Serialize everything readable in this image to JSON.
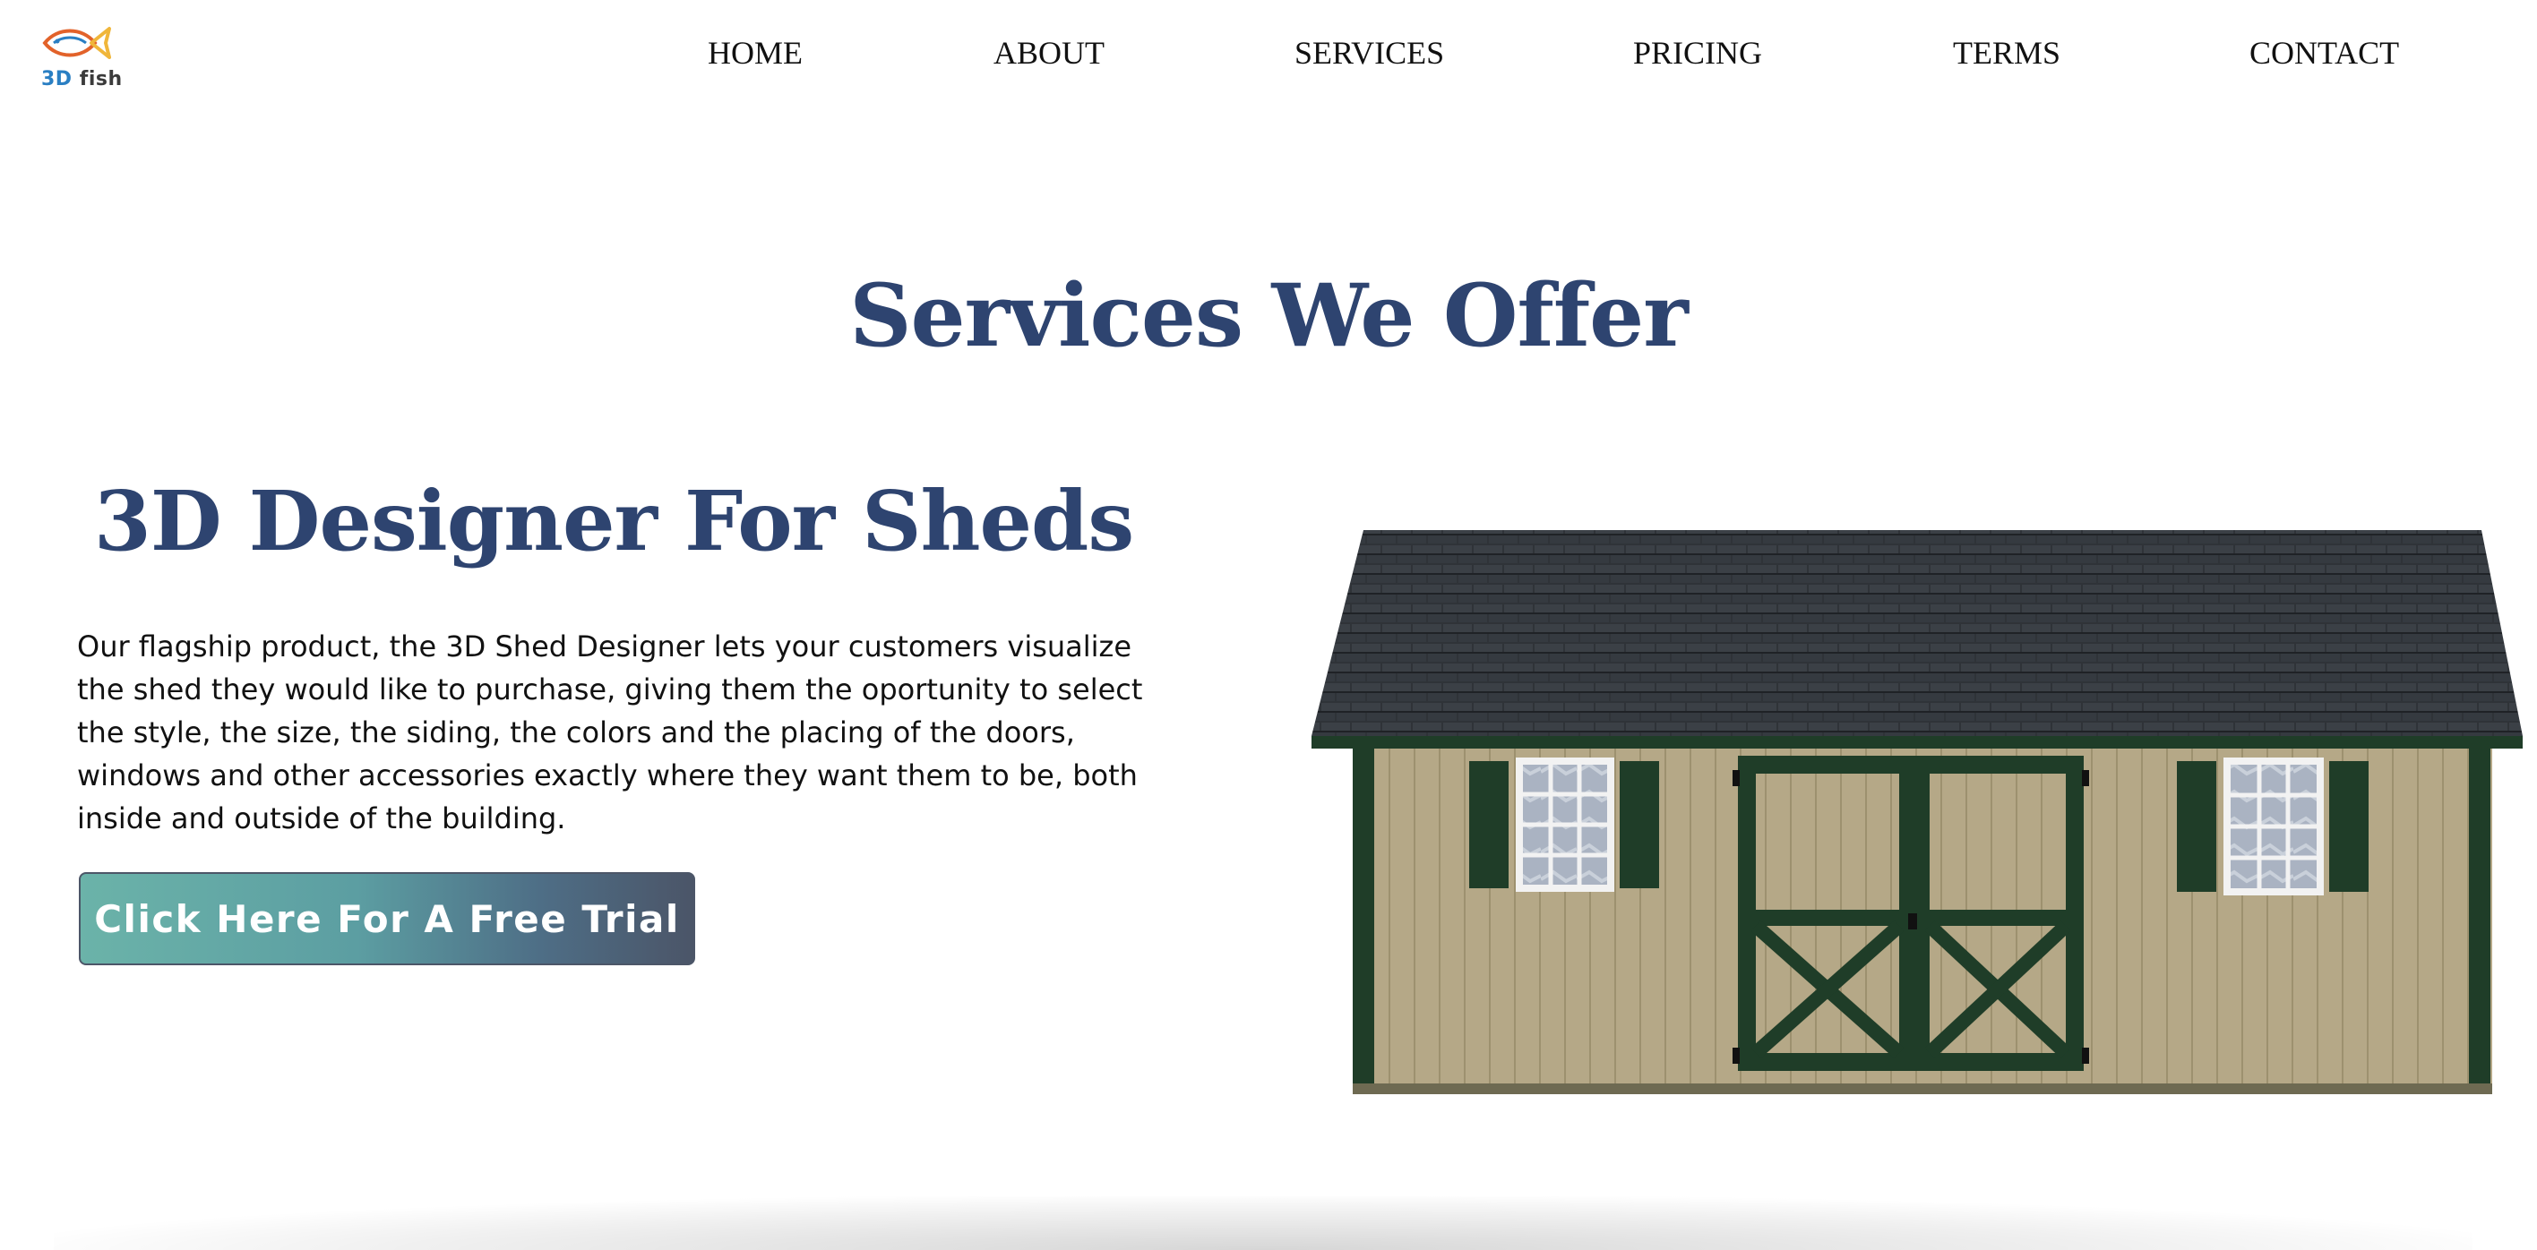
{
  "logo": {
    "mark": "3D",
    "name": "fish",
    "icon": "fish-logo-icon"
  },
  "nav": {
    "items": [
      "HOME",
      "ABOUT",
      "SERVICES",
      "PRICING",
      "TERMS",
      "CONTACT"
    ]
  },
  "page": {
    "title": "Services We Offer"
  },
  "service": {
    "title": "3D Designer For Sheds",
    "description": "Our flagship product, the 3D Shed Designer lets your customers visualize the shed they would like to purchase, giving them the oportunity to select the style, the size, the siding, the colors and the placing of the doors, windows and other accessories exactly where they want them to be, both inside and outside of the building.",
    "cta_label": "Click Here For A Free Trial",
    "image": "shed-product-image"
  },
  "colors": {
    "heading": "#2e4470",
    "cta_start": "#6bb3a9",
    "cta_end": "#4b5568",
    "roof": "#2f3338",
    "siding": "#b5a887",
    "trim": "#1f3d28"
  }
}
